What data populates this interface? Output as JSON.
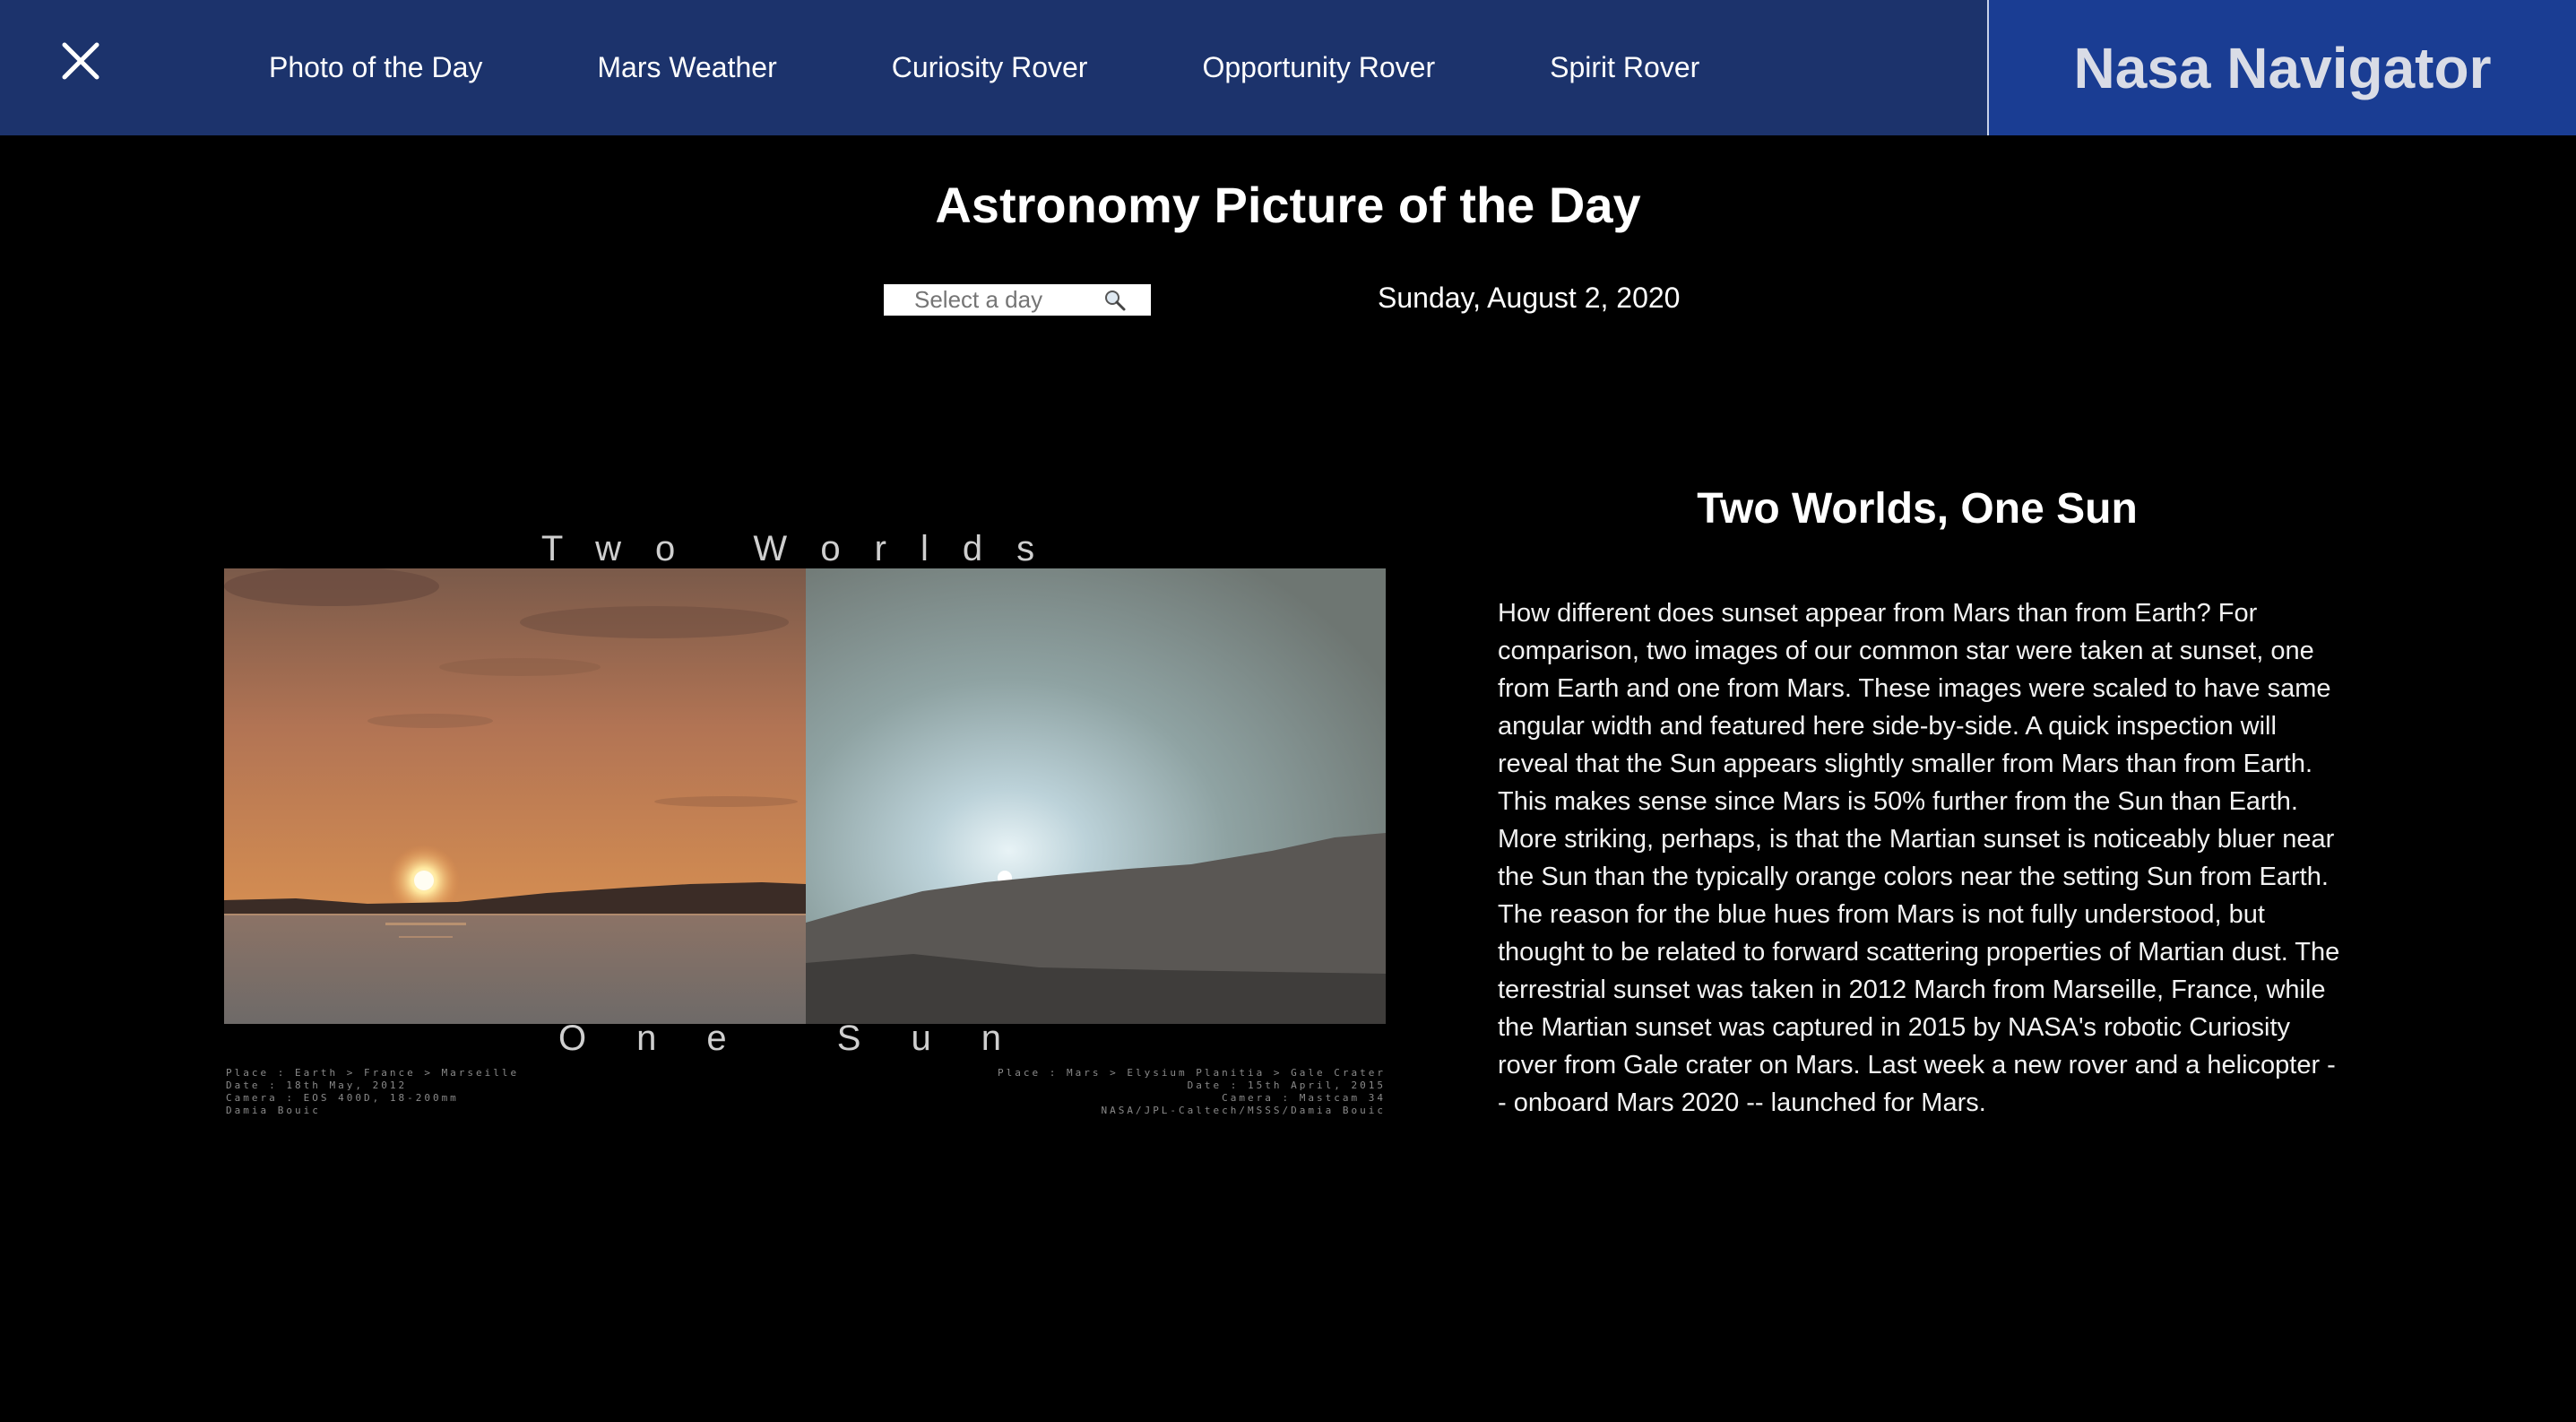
{
  "nav": {
    "links": [
      "Photo of the Day",
      "Mars Weather",
      "Curiosity Rover",
      "Opportunity Rover",
      "Spirit Rover"
    ],
    "brand": "Nasa Navigator"
  },
  "page": {
    "title": "Astronomy Picture of the Day",
    "date_picker_placeholder": "Select a day",
    "current_date": "Sunday, August 2, 2020"
  },
  "image": {
    "title_top": "Two Worlds",
    "title_bottom": "One Sun",
    "caption_left": [
      "Place : Earth > France > Marseille",
      "Date : 18th May, 2012",
      "Camera : EOS 400D, 18-200mm",
      "Damia Bouic"
    ],
    "caption_right": [
      "Place : Mars > Elysium Planitia > Gale Crater",
      "Date : 15th April, 2015",
      "Camera : Mastcam 34",
      "NASA/JPL-Caltech/MSSS/Damia Bouic"
    ]
  },
  "explanation": {
    "title": "Two Worlds, One Sun",
    "text": "How different does sunset appear from Mars than from Earth? For comparison, two images of our common star were taken at sunset, one from Earth and one from Mars. These images were scaled to have same angular width and featured here side-by-side. A quick inspection will reveal that the Sun appears slightly smaller from Mars than from Earth. This makes sense since Mars is 50% further from the Sun than Earth. More striking, perhaps, is that the Martian sunset is noticeably bluer near the Sun than the typically orange colors near the setting Sun from Earth. The reason for the blue hues from Mars is not fully understood, but thought to be related to forward scattering properties of Martian dust. The terrestrial sunset was taken in 2012 March from Marseille, France, while the Martian sunset was captured in 2015 by NASA's robotic Curiosity rover from Gale crater on Mars. Last week a new rover and a helicopter -- onboard Mars 2020 -- launched for Mars."
  },
  "colors": {
    "navbar": "#1c336c",
    "brand_bg": "#1a3d93",
    "page_bg": "#000000"
  }
}
